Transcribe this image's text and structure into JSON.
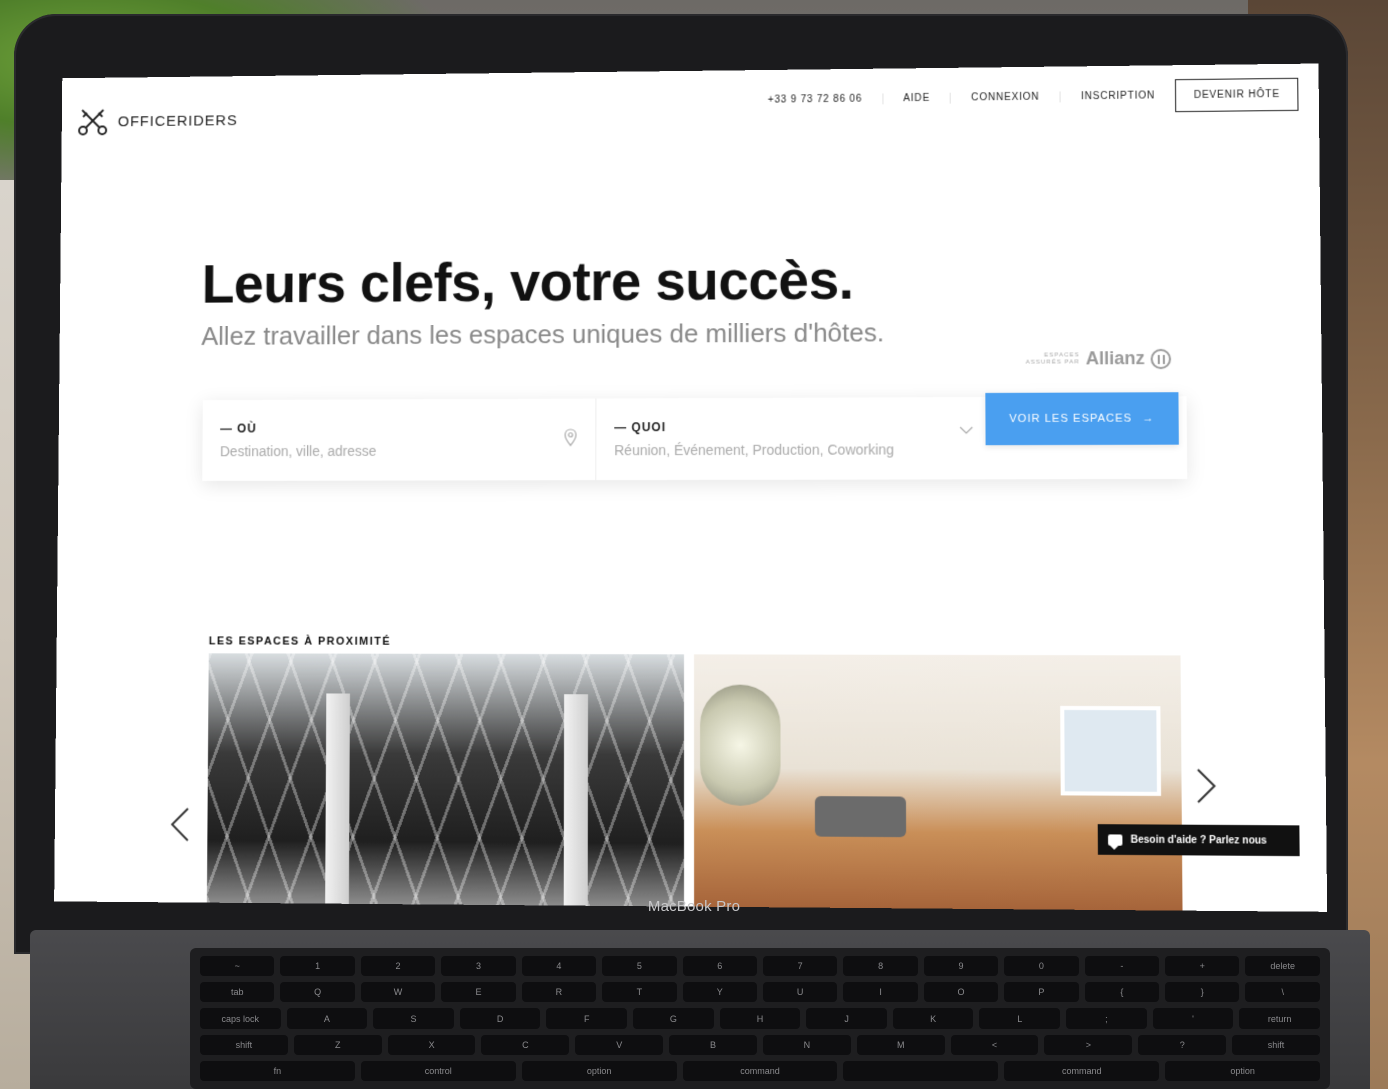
{
  "header": {
    "logo_text": "OFFICERIDERS",
    "nav": {
      "phone": "+33 9 73 72 86 06",
      "help": "AIDE",
      "login": "CONNEXION",
      "signup": "INSCRIPTION",
      "become_host": "DEVENIR HÔTE"
    }
  },
  "hero": {
    "title": "Leurs clefs, votre succès.",
    "subtitle": "Allez travailler dans les espaces uniques de milliers d'hôtes."
  },
  "insurance": {
    "line1": "ESPACES",
    "line2": "ASSURÉS PAR",
    "brand": "Allianz"
  },
  "search": {
    "where_label": "— OÙ",
    "where_placeholder": "Destination, ville, adresse",
    "what_label": "— QUOI",
    "what_placeholder": "Réunion, Événement, Production, Coworking",
    "button_label": "VOIR LES ESPACES",
    "button_arrow": "→"
  },
  "nearby": {
    "title": "LES ESPACES À PROXIMITÉ"
  },
  "chat": {
    "label": "Besoin d'aide ? Parlez nous"
  },
  "device": {
    "brand": "MacBook Pro"
  },
  "keyboard": {
    "rows": [
      [
        "~",
        "1",
        "2",
        "3",
        "4",
        "5",
        "6",
        "7",
        "8",
        "9",
        "0",
        "-",
        "+",
        "delete"
      ],
      [
        "tab",
        "Q",
        "W",
        "E",
        "R",
        "T",
        "Y",
        "U",
        "I",
        "O",
        "P",
        "{",
        "}",
        "\\"
      ],
      [
        "caps lock",
        "A",
        "S",
        "D",
        "F",
        "G",
        "H",
        "J",
        "K",
        "L",
        ";",
        "'",
        "return"
      ],
      [
        "shift",
        "Z",
        "X",
        "C",
        "V",
        "B",
        "N",
        "M",
        "<",
        ">",
        "?",
        "shift"
      ],
      [
        "fn",
        "control",
        "option",
        "command",
        "",
        "command",
        "option"
      ]
    ]
  }
}
